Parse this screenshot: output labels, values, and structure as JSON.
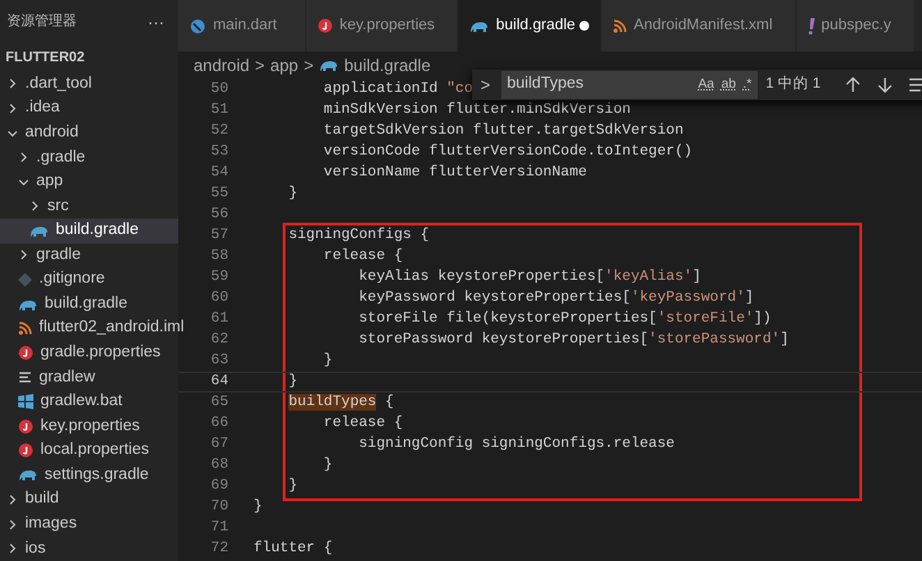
{
  "sidebar": {
    "title": "资源管理器",
    "more": "···",
    "project": "FLUTTER02",
    "items": [
      {
        "label": ".dart_tool",
        "kind": "folder",
        "expanded": false,
        "selected": false
      },
      {
        "label": ".idea",
        "kind": "folder",
        "expanded": false,
        "selected": false
      },
      {
        "label": "android",
        "kind": "folder",
        "expanded": true,
        "selected": false,
        "children": [
          {
            "label": ".gradle",
            "kind": "folder",
            "expanded": false,
            "selected": false
          },
          {
            "label": "app",
            "kind": "folder",
            "expanded": true,
            "selected": false,
            "children": [
              {
                "label": "src",
                "kind": "folder",
                "expanded": false,
                "selected": false
              },
              {
                "label": "build.gradle",
                "kind": "gradle",
                "selected": true
              }
            ]
          },
          {
            "label": "gradle",
            "kind": "folder",
            "expanded": false,
            "selected": false
          },
          {
            "label": ".gitignore",
            "kind": "git",
            "selected": false
          },
          {
            "label": "build.gradle",
            "kind": "gradle",
            "selected": false
          },
          {
            "label": "flutter02_android.iml",
            "kind": "xml",
            "selected": false
          },
          {
            "label": "gradle.properties",
            "kind": "properties",
            "selected": false
          },
          {
            "label": "gradlew",
            "kind": "text",
            "selected": false
          },
          {
            "label": "gradlew.bat",
            "kind": "bat",
            "selected": false
          },
          {
            "label": "key.properties",
            "kind": "properties",
            "selected": false
          },
          {
            "label": "local.properties",
            "kind": "properties",
            "selected": false
          },
          {
            "label": "settings.gradle",
            "kind": "gradle",
            "selected": false
          }
        ]
      },
      {
        "label": "build",
        "kind": "folder",
        "expanded": false,
        "selected": false
      },
      {
        "label": "images",
        "kind": "folder",
        "expanded": false,
        "selected": false
      },
      {
        "label": "ios",
        "kind": "folder",
        "expanded": false,
        "selected": false
      }
    ]
  },
  "tabs": [
    {
      "label": "main.dart",
      "kind": "dart",
      "selected": false,
      "modified": false
    },
    {
      "label": "key.properties",
      "kind": "properties",
      "selected": false,
      "modified": false
    },
    {
      "label": "build.gradle",
      "kind": "gradle",
      "selected": true,
      "modified": true
    },
    {
      "label": "AndroidManifest.xml",
      "kind": "xml",
      "selected": false,
      "modified": false
    },
    {
      "label": "pubspec.y",
      "kind": "yaml",
      "selected": false,
      "modified": false
    }
  ],
  "breadcrumb": [
    {
      "label": "android",
      "kind": "folder"
    },
    {
      "label": "app",
      "kind": "folder"
    },
    {
      "label": "build.gradle",
      "kind": "gradle"
    }
  ],
  "separator": ">",
  "find": {
    "toggle": ">",
    "value": "buildTypes",
    "options": [
      "Aa",
      "ab",
      ".*"
    ],
    "count": "1 中的 1"
  },
  "lines": [
    {
      "number": "50",
      "current": false,
      "framed": false,
      "parts": [
        {
          "text": "        applicationId ",
          "kind": "plain"
        },
        {
          "text": "\"co",
          "kind": "string"
        }
      ]
    },
    {
      "number": "51",
      "current": false,
      "framed": false,
      "parts": [
        {
          "text": "        minSdkVersion flutter.minSdkVersion",
          "kind": "plain"
        }
      ]
    },
    {
      "number": "52",
      "current": false,
      "framed": false,
      "parts": [
        {
          "text": "        targetSdkVersion flutter.targetSdkVersion",
          "kind": "plain"
        }
      ]
    },
    {
      "number": "53",
      "current": false,
      "framed": false,
      "parts": [
        {
          "text": "        versionCode flutterVersionCode.toInteger()",
          "kind": "plain"
        }
      ]
    },
    {
      "number": "54",
      "current": false,
      "framed": false,
      "parts": [
        {
          "text": "        versionName flutterVersionName",
          "kind": "plain"
        }
      ]
    },
    {
      "number": "55",
      "current": false,
      "framed": false,
      "parts": [
        {
          "text": "    }",
          "kind": "plain"
        }
      ]
    },
    {
      "number": "56",
      "current": false,
      "framed": false
    },
    {
      "number": "57",
      "current": false,
      "framed": true,
      "parts": [
        {
          "text": "    signingConfigs {",
          "kind": "plain"
        }
      ]
    },
    {
      "number": "58",
      "current": false,
      "framed": true,
      "parts": [
        {
          "text": "        release {",
          "kind": "plain"
        }
      ]
    },
    {
      "number": "59",
      "current": false,
      "framed": true,
      "parts": [
        {
          "text": "            keyAlias keystoreProperties[",
          "kind": "plain"
        },
        {
          "text": "'keyAlias'",
          "kind": "string"
        },
        {
          "text": "]",
          "kind": "plain"
        }
      ]
    },
    {
      "number": "60",
      "current": false,
      "framed": true,
      "parts": [
        {
          "text": "            keyPassword keystoreProperties[",
          "kind": "plain"
        },
        {
          "text": "'keyPassword'",
          "kind": "string"
        },
        {
          "text": "]",
          "kind": "plain"
        }
      ]
    },
    {
      "number": "61",
      "current": false,
      "framed": true,
      "parts": [
        {
          "text": "            storeFile file(keystoreProperties[",
          "kind": "plain"
        },
        {
          "text": "'storeFile'",
          "kind": "string"
        },
        {
          "text": "])",
          "kind": "plain"
        }
      ]
    },
    {
      "number": "62",
      "current": false,
      "framed": true,
      "parts": [
        {
          "text": "            storePassword keystoreProperties[",
          "kind": "plain"
        },
        {
          "text": "'storePassword'",
          "kind": "string"
        },
        {
          "text": "]",
          "kind": "plain"
        }
      ]
    },
    {
      "number": "63",
      "current": false,
      "framed": true,
      "parts": [
        {
          "text": "        }",
          "kind": "plain"
        }
      ]
    },
    {
      "number": "64",
      "current": true,
      "framed": true,
      "parts": [
        {
          "text": "    }",
          "kind": "plain"
        }
      ]
    },
    {
      "number": "65",
      "current": false,
      "framed": true,
      "parts": [
        {
          "text": "    buildTypes",
          "kind": "match"
        },
        {
          "text": " {",
          "kind": "plain"
        }
      ]
    },
    {
      "number": "66",
      "current": false,
      "framed": true,
      "parts": [
        {
          "text": "        release {",
          "kind": "plain"
        }
      ]
    },
    {
      "number": "67",
      "current": false,
      "framed": true,
      "parts": [
        {
          "text": "            signingConfig signingConfigs.release",
          "kind": "plain"
        }
      ]
    },
    {
      "number": "68",
      "current": false,
      "framed": true,
      "parts": [
        {
          "text": "        }",
          "kind": "plain"
        }
      ]
    },
    {
      "number": "69",
      "current": false,
      "framed": true,
      "parts": [
        {
          "text": "    }",
          "kind": "plain"
        }
      ]
    },
    {
      "number": "70",
      "current": false,
      "framed": false,
      "parts": [
        {
          "text": "}",
          "kind": "plain"
        }
      ]
    },
    {
      "number": "71",
      "current": false,
      "framed": false
    },
    {
      "number": "72",
      "current": false,
      "framed": false,
      "parts": [
        {
          "text": "flutter {",
          "kind": "plain"
        }
      ]
    }
  ]
}
